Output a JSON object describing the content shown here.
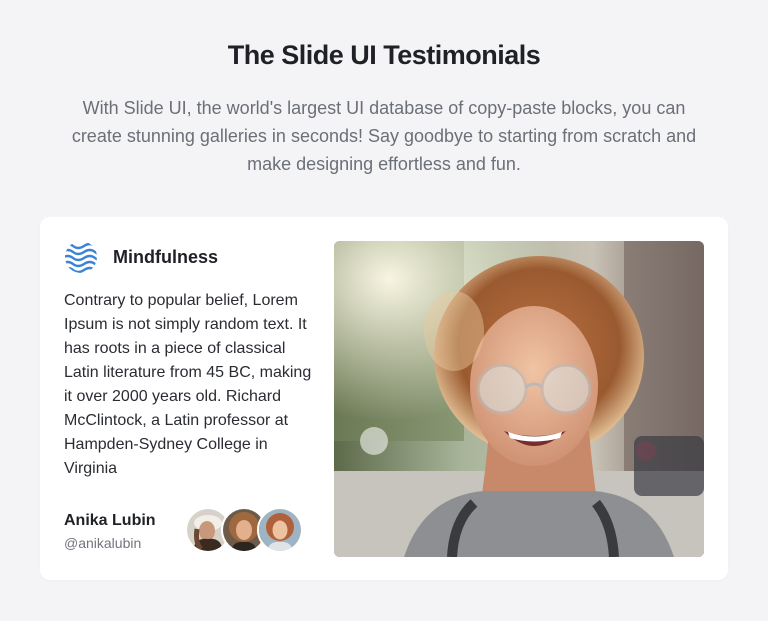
{
  "header": {
    "title": "The Slide UI Testimonials",
    "subtitle": "With Slide UI, the world's largest UI database of copy-paste blocks, you can create stunning galleries in seconds! Say goodbye to starting from scratch and make designing effortless and fun."
  },
  "testimonial": {
    "brand": {
      "icon": "waves-logo-icon",
      "name": "Mindfulness",
      "color": "#3b82d6"
    },
    "quote": "Contrary to popular belief, Lorem Ipsum is not simply random text. It has roots in a piece of classical Latin literature from 45 BC, making it over 2000 years old. Richard McClintock, a Latin professor at Hampden-Sydney College in Virginia",
    "author": {
      "name": "Anika Lubin",
      "handle": "@anikalubin"
    },
    "avatars": [
      "avatar-1",
      "avatar-2",
      "avatar-3"
    ]
  },
  "colors": {
    "page_background": "#f4f4f6",
    "card_background": "#ffffff",
    "title_text": "#1f2127",
    "muted_text": "#6b6f78"
  }
}
